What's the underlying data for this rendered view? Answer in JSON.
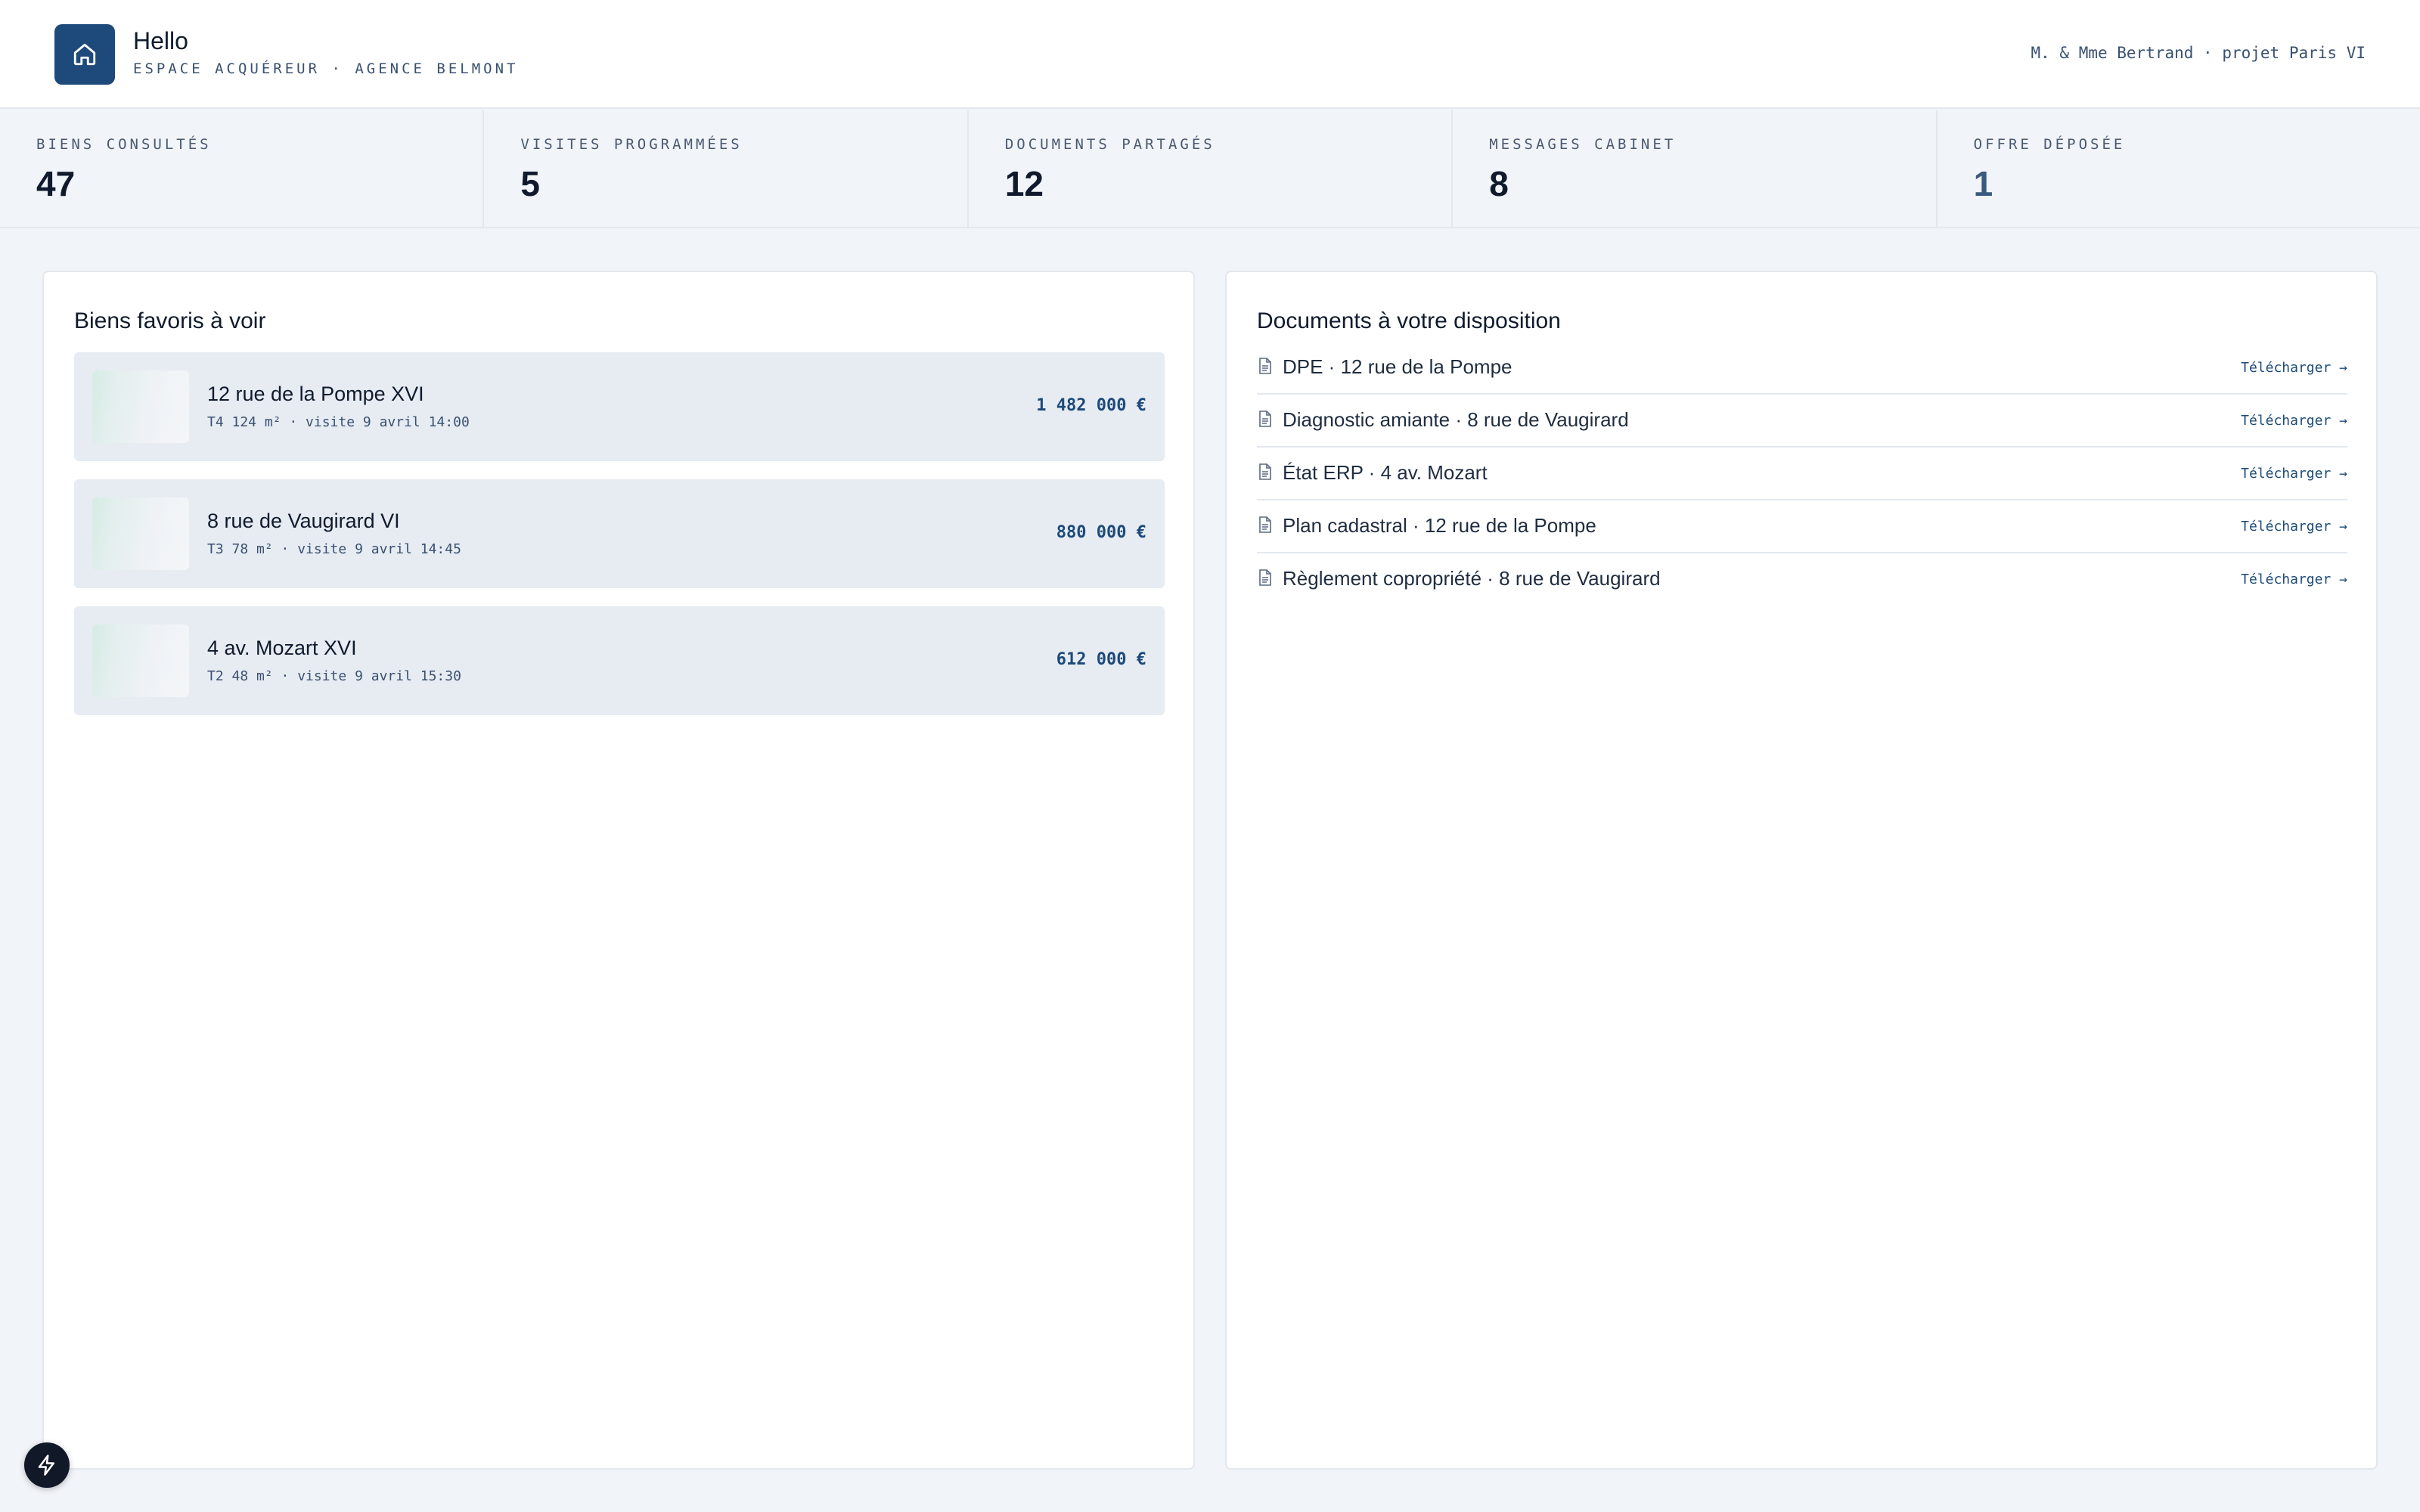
{
  "header": {
    "title": "Hello",
    "subtitle": "ESPACE ACQUÉREUR · AGENCE BELMONT",
    "user": "M. & Mme Bertrand · projet Paris VI",
    "logo_icon": "home-icon"
  },
  "stats": [
    {
      "label": "BIENS CONSULTÉS",
      "value": "47"
    },
    {
      "label": "VISITES PROGRAMMÉES",
      "value": "5"
    },
    {
      "label": "DOCUMENTS PARTAGÉS",
      "value": "12"
    },
    {
      "label": "MESSAGES CABINET",
      "value": "8"
    },
    {
      "label": "OFFRE DÉPOSÉE",
      "value": "1"
    }
  ],
  "favorites": {
    "title": "Biens favoris à voir",
    "items": [
      {
        "name": "12 rue de la Pompe XVI",
        "meta": "T4 124 m² · visite 9 avril 14:00",
        "price": "1 482 000 €"
      },
      {
        "name": "8 rue de Vaugirard VI",
        "meta": "T3 78 m² · visite 9 avril 14:45",
        "price": "880 000 €"
      },
      {
        "name": "4 av. Mozart XVI",
        "meta": "T2 48 m² · visite 9 avril 15:30",
        "price": "612 000 €"
      }
    ]
  },
  "documents": {
    "title": "Documents à votre disposition",
    "items": [
      {
        "name": "DPE · 12 rue de la Pompe",
        "action": "Télécharger →"
      },
      {
        "name": "Diagnostic amiante · 8 rue de Vaugirard",
        "action": "Télécharger →"
      },
      {
        "name": "État ERP · 4 av. Mozart",
        "action": "Télécharger →"
      },
      {
        "name": "Plan cadastral · 12 rue de la Pompe",
        "action": "Télécharger →"
      },
      {
        "name": "Règlement copropriété · 8 rue de Vaugirard",
        "action": "Télécharger →"
      }
    ]
  },
  "colors": {
    "brand": "#1d4a7a",
    "background": "#f1f4f8",
    "card": "#e7ecf3"
  },
  "fab_icon": "lightning-icon"
}
